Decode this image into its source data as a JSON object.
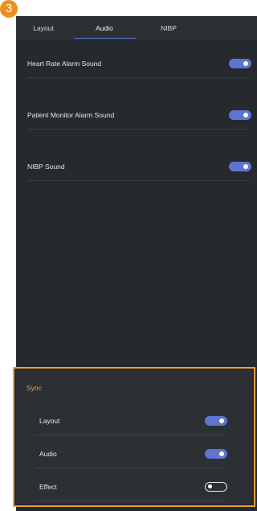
{
  "step_badge": "3",
  "tabs": [
    {
      "label": "Layout"
    },
    {
      "label": "Audio"
    },
    {
      "label": "NIBP"
    }
  ],
  "audio_settings": [
    {
      "label": "Heart Rate Alarm Sound",
      "enabled": true
    },
    {
      "label": "Patient Monitor Alarm Sound",
      "enabled": true
    },
    {
      "label": "NIBP Sound",
      "enabled": true
    }
  ],
  "sync": {
    "title": "Sync",
    "items": [
      {
        "label": "Layout",
        "enabled": true
      },
      {
        "label": "Audio",
        "enabled": true
      },
      {
        "label": "Effect",
        "enabled": false
      }
    ]
  },
  "colors": {
    "accent": "#5d74d1",
    "highlight": "#e9a03b",
    "badge": "#ee8e1f",
    "panel_bg": "#26292e"
  }
}
